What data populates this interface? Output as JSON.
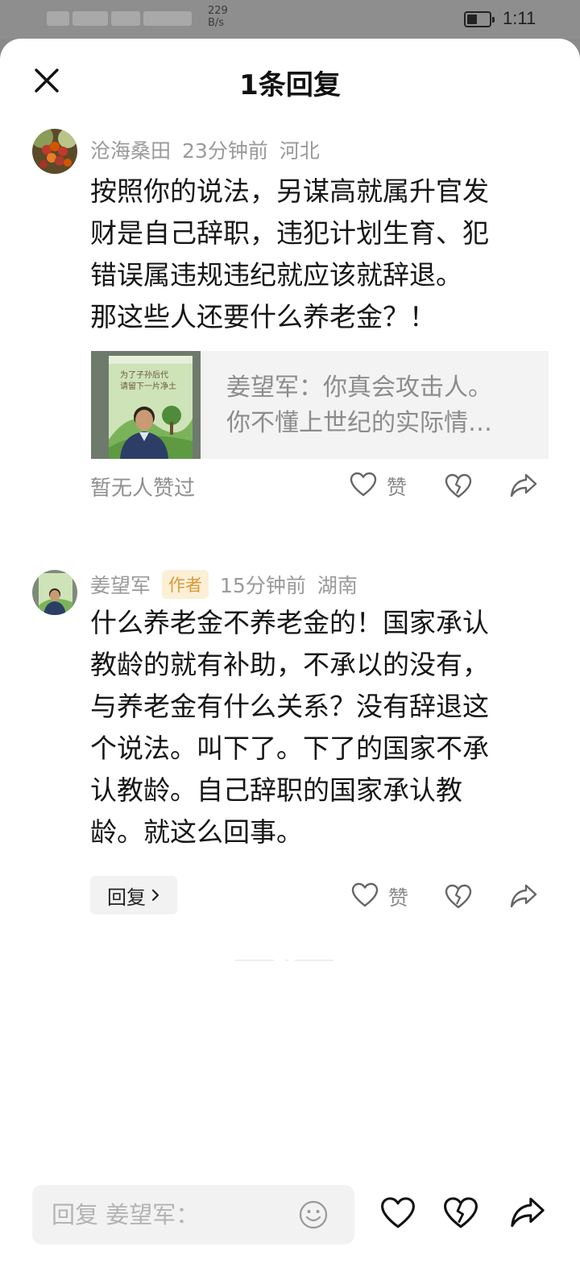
{
  "status": {
    "speed_value": "229",
    "speed_unit": "B/s",
    "time": "1:11"
  },
  "header": {
    "title": "1条回复"
  },
  "comment": {
    "username": "沧海桑田",
    "time": "23分钟前",
    "location": "河北",
    "lines": [
      "按照你的说法，另谋高就属升官发",
      "财是自己辞职，违犯计划生育、犯",
      "错误属违规违纪就应该就辞退。",
      "那这些人还要什么养老金？！"
    ],
    "quote": {
      "thumb_caption_1": "为了子孙后代",
      "thumb_caption_2": "请留下一片净土",
      "line1": "姜望军：你真会攻击人。",
      "line2": "你不懂上世纪的实际情…"
    },
    "no_likes_text": "暂无人赞过",
    "like_label": "赞"
  },
  "reply": {
    "username": "姜望军",
    "author_tag": "作者",
    "time": "15分钟前",
    "location": "湖南",
    "lines": [
      "什么养老金不养老金的！国家承认",
      "教龄的就有补助，不承以的没有，",
      "与养老金有什么关系？没有辞退这",
      "个说法。叫下了。下了的国家不承",
      "认教龄。自己辞职的国家承认教",
      "龄。就这么回事。"
    ],
    "reply_button": "回复",
    "like_label": "赞"
  },
  "input": {
    "placeholder": "回复 姜望军："
  },
  "icons": [
    "close-icon",
    "heart-icon",
    "broken-heart-icon",
    "share-icon",
    "emoji-icon",
    "chevron-right-icon"
  ]
}
